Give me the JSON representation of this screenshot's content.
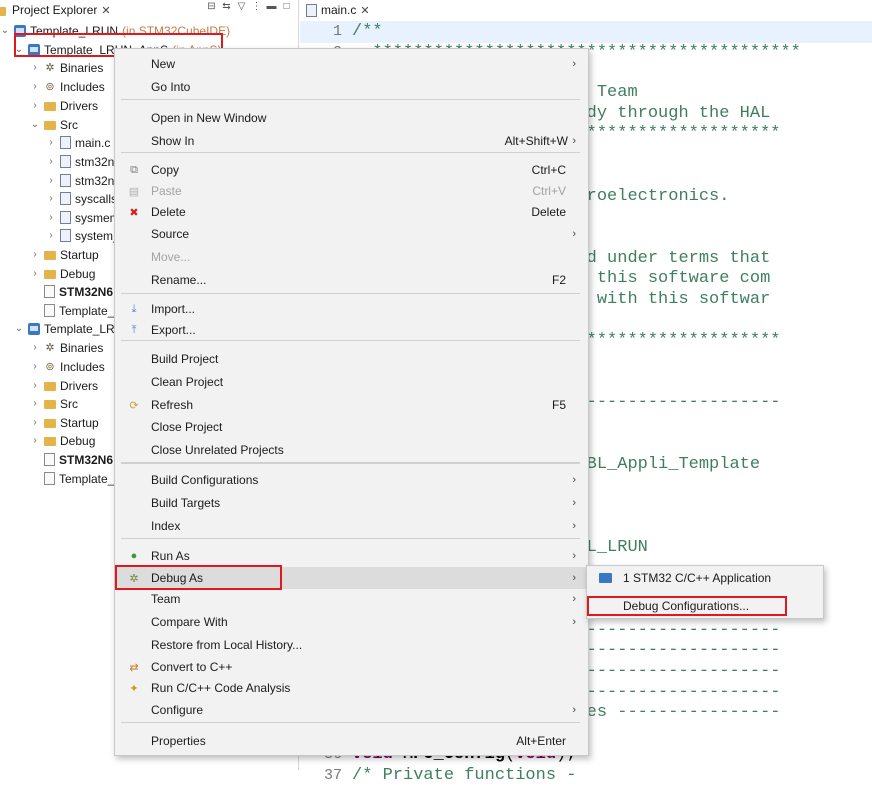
{
  "explorer": {
    "tab_label": "Project Explorer",
    "tree": [
      {
        "label": "Template_LRUN",
        "suffix": "(in STM32CubeIDE)"
      },
      {
        "label": "Template_LRUN_AppS",
        "suffix": "(in AppS)"
      },
      {
        "label": "Binaries"
      },
      {
        "label": "Includes"
      },
      {
        "label": "Drivers"
      },
      {
        "label": "Src"
      },
      {
        "label": "main.c"
      },
      {
        "label": "stm32n"
      },
      {
        "label": "stm32n"
      },
      {
        "label": "syscalls"
      },
      {
        "label": "sysmem"
      },
      {
        "label": "system_"
      },
      {
        "label": "Startup"
      },
      {
        "label": "Debug"
      },
      {
        "label": "STM32N6"
      },
      {
        "label": "Template_L"
      },
      {
        "label": "Template_LRU"
      },
      {
        "label": "Binaries"
      },
      {
        "label": "Includes"
      },
      {
        "label": "Drivers"
      },
      {
        "label": "Src"
      },
      {
        "label": "Startup"
      },
      {
        "label": "Debug"
      },
      {
        "label": "STM32N6"
      },
      {
        "label": "Template_L"
      }
    ]
  },
  "editor": {
    "tab_label": "main.c",
    "lines": [
      {
        "num": "1",
        "text": "/**"
      },
      {
        "num": "2",
        "text": "  ******************************************"
      },
      {
        "num": "",
        "text": "                ication Team"
      },
      {
        "num": "",
        "text": "                gram body through the HAL"
      },
      {
        "num": "",
        "text": "                **************************"
      },
      {
        "num": "",
        "text": "                3 STMicroelectronics."
      },
      {
        "num": "",
        "text": "                ed."
      },
      {
        "num": "",
        "text": "                licensed under terms that"
      },
      {
        "num": "",
        "text": "                tory of this software com"
      },
      {
        "num": "",
        "text": "                e comes with this softwar"
      },
      {
        "num": "",
        "text": "                **************************"
      },
      {
        "num": "",
        "text": "                --------------------------"
      },
      {
        "num": "",
        "text": "                N6xx_FSBL_Appli_Template"
      },
      {
        "num": "",
        "text": "                ate_FSBL_LRUN"
      },
      {
        "num": "",
        "text": "                --------------------------"
      },
      {
        "num": "",
        "text": "                --------------------------"
      },
      {
        "num": "",
        "text": "                --------------------------"
      },
      {
        "num": "",
        "text": "                --------------------------"
      },
      {
        "num": "",
        "text": "                rototypes ----------------"
      },
      {
        "num": "",
        "text": "                id);"
      },
      {
        "num": "36",
        "text": "void MPU_Config(void);"
      },
      {
        "num": "37",
        "text": "/* Private functions -"
      }
    ]
  },
  "context_menu": {
    "items": [
      {
        "label": "New",
        "accel": "",
        "submenu": true,
        "icon": ""
      },
      {
        "label": "Go Into",
        "accel": "",
        "submenu": false,
        "icon": ""
      },
      {
        "label": "Open in New Window",
        "accel": "",
        "submenu": false,
        "icon": ""
      },
      {
        "label": "Show In",
        "accel": "Alt+Shift+W",
        "submenu": true,
        "icon": ""
      },
      {
        "label": "Copy",
        "accel": "Ctrl+C",
        "submenu": false,
        "icon": "copy-icon"
      },
      {
        "label": "Paste",
        "accel": "Ctrl+V",
        "submenu": false,
        "icon": "paste-icon",
        "disabled": true
      },
      {
        "label": "Delete",
        "accel": "Delete",
        "submenu": false,
        "icon": "delete-icon"
      },
      {
        "label": "Source",
        "accel": "",
        "submenu": true,
        "icon": ""
      },
      {
        "label": "Move...",
        "accel": "",
        "submenu": false,
        "icon": "",
        "disabled": true
      },
      {
        "label": "Rename...",
        "accel": "F2",
        "submenu": false,
        "icon": ""
      },
      {
        "label": "Import...",
        "accel": "",
        "submenu": false,
        "icon": "import-icon"
      },
      {
        "label": "Export...",
        "accel": "",
        "submenu": false,
        "icon": "export-icon"
      },
      {
        "label": "Build Project",
        "accel": "",
        "submenu": false,
        "icon": ""
      },
      {
        "label": "Clean Project",
        "accel": "",
        "submenu": false,
        "icon": ""
      },
      {
        "label": "Refresh",
        "accel": "F5",
        "submenu": false,
        "icon": "refresh-icon"
      },
      {
        "label": "Close Project",
        "accel": "",
        "submenu": false,
        "icon": ""
      },
      {
        "label": "Close Unrelated Projects",
        "accel": "",
        "submenu": false,
        "icon": ""
      },
      {
        "label": "Build Configurations",
        "accel": "",
        "submenu": true,
        "icon": ""
      },
      {
        "label": "Build Targets",
        "accel": "",
        "submenu": true,
        "icon": ""
      },
      {
        "label": "Index",
        "accel": "",
        "submenu": true,
        "icon": ""
      },
      {
        "label": "Run As",
        "accel": "",
        "submenu": true,
        "icon": "run-icon"
      },
      {
        "label": "Debug As",
        "accel": "",
        "submenu": true,
        "icon": "debug-icon"
      },
      {
        "label": "Team",
        "accel": "",
        "submenu": true,
        "icon": ""
      },
      {
        "label": "Compare With",
        "accel": "",
        "submenu": true,
        "icon": ""
      },
      {
        "label": "Restore from Local History...",
        "accel": "",
        "submenu": false,
        "icon": ""
      },
      {
        "label": "Convert to C++",
        "accel": "",
        "submenu": false,
        "icon": "convert-icon"
      },
      {
        "label": "Run C/C++ Code Analysis",
        "accel": "",
        "submenu": false,
        "icon": "analysis-icon"
      },
      {
        "label": "Configure",
        "accel": "",
        "submenu": true,
        "icon": ""
      },
      {
        "label": "Properties",
        "accel": "Alt+Enter",
        "submenu": false,
        "icon": ""
      }
    ]
  },
  "submenu": {
    "items": [
      {
        "label": "1 STM32 C/C++ Application"
      },
      {
        "label": "Debug Configurations..."
      }
    ]
  }
}
